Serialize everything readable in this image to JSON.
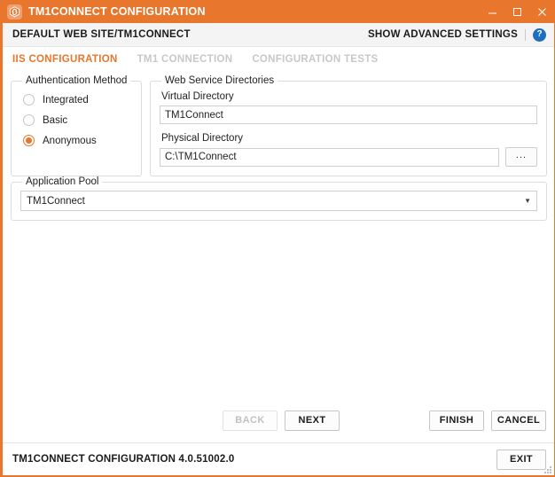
{
  "titlebar": {
    "title": "TM1CONNECT CONFIGURATION",
    "icon": "chain-link-icon",
    "minimize": "—",
    "maximize": "☐",
    "close": "✕"
  },
  "subbar": {
    "breadcrumb": "DEFAULT WEB SITE/TM1CONNECT",
    "advanced_label": "SHOW ADVANCED SETTINGS",
    "help_icon": "question-mark-icon",
    "help_glyph": "?"
  },
  "tabs": [
    {
      "label": "IIS CONFIGURATION",
      "active": true
    },
    {
      "label": "TM1 CONNECTION",
      "active": false
    },
    {
      "label": "CONFIGURATION TESTS",
      "active": false
    }
  ],
  "auth_group": {
    "legend": "Authentication Method",
    "options": [
      {
        "label": "Integrated",
        "checked": false
      },
      {
        "label": "Basic",
        "checked": false
      },
      {
        "label": "Anonymous",
        "checked": true
      }
    ]
  },
  "web_service_group": {
    "legend": "Web Service Directories",
    "virtual_directory": {
      "label": "Virtual Directory",
      "value": "TM1Connect",
      "placeholder": ""
    },
    "physical_directory": {
      "label": "Physical Directory",
      "value": "C:\\TM1Connect",
      "placeholder": "",
      "browse_label": "..."
    }
  },
  "app_pool_group": {
    "legend": "Application Pool",
    "selected": "TM1Connect",
    "caret": "▼"
  },
  "buttons": {
    "back": "BACK",
    "next": "NEXT",
    "finish": "FINISH",
    "cancel": "CANCEL"
  },
  "statusbar": {
    "text": "TM1CONNECT CONFIGURATION 4.0.51002.0",
    "exit": "EXIT"
  },
  "colors": {
    "accent": "#e8762c",
    "tab_inactive": "#c8c8c8",
    "help_blue": "#1c6fc0",
    "subbar_bg": "#f4f4f4"
  }
}
